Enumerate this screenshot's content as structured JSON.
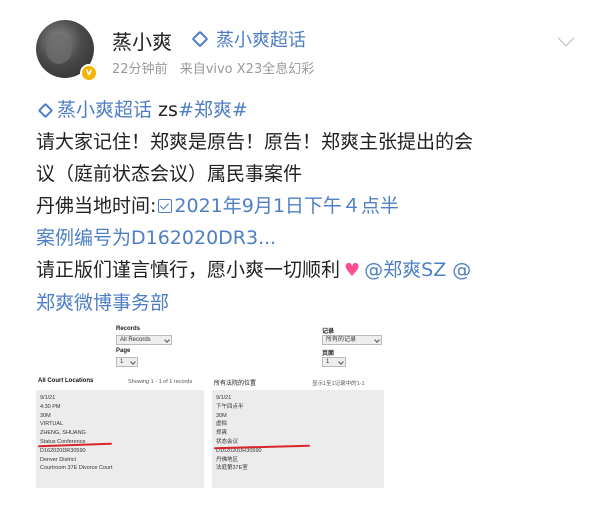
{
  "post": {
    "username": "蒸小爽",
    "topic_tag": "蒸小爽超话",
    "time_ago": "22分钟前",
    "source": "来自vivo X23全息幻彩",
    "line1_topic": "蒸小爽超话",
    "line1_text": " zs",
    "line1_hashtag": "#郑爽#",
    "line2": "请大家记住！郑爽是原告！原告！郑爽主张提出的会",
    "line3": "议（庭前状态会议）属民事案件",
    "line4_prefix": "丹佛当地时间:",
    "line4_link": "2021年9月1日下午４点半",
    "line5_link": "案例编号为D162020DR3...",
    "line6_text": "请正版们谨言慎行，愿小爽一切顺利",
    "line6_mention1": "@郑爽SZ",
    "line6_mention2": "@",
    "line7_mention": "郑爽微博事务部"
  },
  "left_screenshot": {
    "records_label": "Records",
    "records_value": "All Records",
    "page_label": "Page",
    "page_value": "1",
    "heading": "All Court Locations",
    "showing": "Showing 1 - 1 of 1 records",
    "rows": [
      "9/1/21",
      "4:30 PM",
      "30M",
      "VIRTUAL",
      "ZHENG, SHUANG",
      "Status Conference",
      "D162020DR30590",
      "Denver District",
      "Courtroom 37E Divorce Court"
    ]
  },
  "right_screenshot": {
    "records_label": "记录",
    "records_value": "所有的记录",
    "page_label": "页面",
    "page_value": "1",
    "heading": "所有法院的位置",
    "showing": "显示1至1记录中的1-1",
    "rows": [
      "9/1/21",
      "下午四点半",
      "30M",
      "虚拟",
      "郑爽",
      "状态会议",
      "D162020DR30590",
      "丹佛地区",
      "法庭第37E室"
    ]
  },
  "colors": {
    "link": "#4e7fc4",
    "accent_red": "#d9262a",
    "vip_badge": "#f4b400"
  }
}
